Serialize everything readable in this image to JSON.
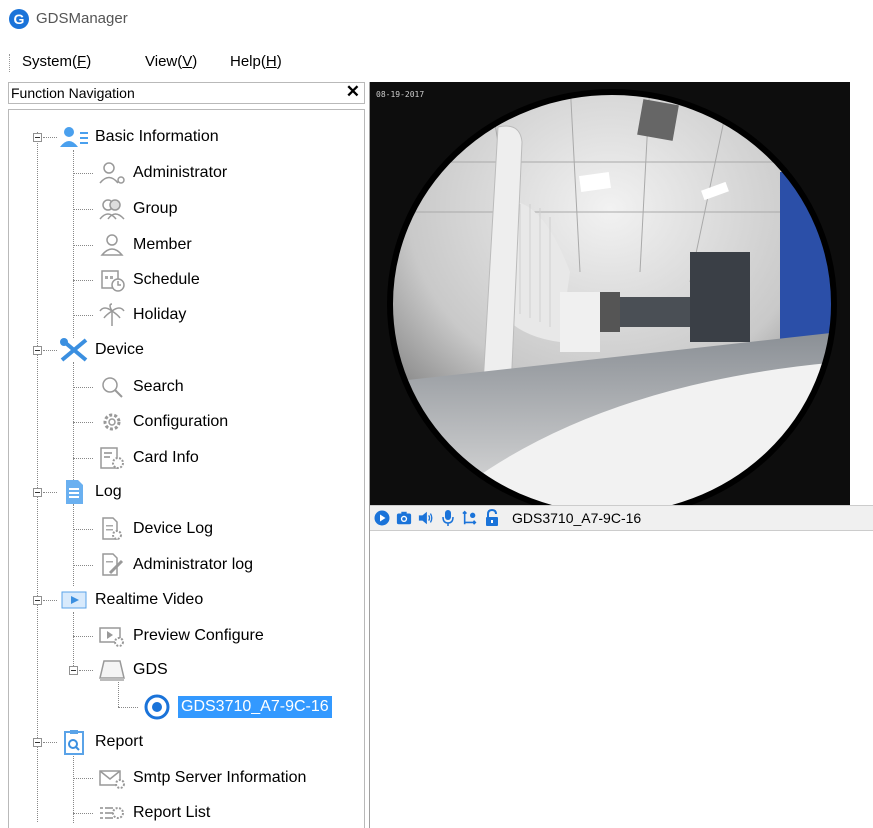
{
  "app": {
    "title": "GDSManager",
    "logo_glyph": "G"
  },
  "menu": [
    {
      "label": "System(",
      "key": "F",
      "end": ")"
    },
    {
      "label": "View(",
      "key": "V",
      "end": ")"
    },
    {
      "label": "Help(",
      "key": "H",
      "end": ")"
    }
  ],
  "nav": {
    "header": "Function Navigation",
    "close_glyph": "✕",
    "items": [
      {
        "label": "Basic Information",
        "icon": "user-list-icon"
      },
      {
        "label": "Administrator",
        "icon": "user-gear-icon"
      },
      {
        "label": "Group",
        "icon": "group-icon"
      },
      {
        "label": "Member",
        "icon": "user-icon"
      },
      {
        "label": "Schedule",
        "icon": "calendar-clock-icon"
      },
      {
        "label": "Holiday",
        "icon": "palm-tree-icon"
      },
      {
        "label": "Device",
        "icon": "tools-icon"
      },
      {
        "label": "Search",
        "icon": "search-icon"
      },
      {
        "label": "Configuration",
        "icon": "gear-icon"
      },
      {
        "label": "Card Info",
        "icon": "card-gear-icon"
      },
      {
        "label": "Log",
        "icon": "document-icon"
      },
      {
        "label": "Device Log",
        "icon": "document-gear-icon"
      },
      {
        "label": "Administrator log",
        "icon": "document-pen-icon"
      },
      {
        "label": "Realtime Video",
        "icon": "play-icon"
      },
      {
        "label": "Preview Configure",
        "icon": "play-gear-icon"
      },
      {
        "label": "GDS",
        "icon": "device-icon"
      },
      {
        "label": "GDS3710_A7-9C-16",
        "icon": "camera-icon"
      },
      {
        "label": "Report",
        "icon": "report-icon"
      },
      {
        "label": "Smtp Server Information",
        "icon": "mail-gear-icon"
      },
      {
        "label": "Report List",
        "icon": "list-gear-icon"
      }
    ]
  },
  "video": {
    "device_name": "GDS3710_A7-9C-16",
    "osd": "08-19-2017",
    "toolbar": [
      "play-icon",
      "snapshot-icon",
      "speaker-icon",
      "microphone-icon",
      "ptz-icon",
      "unlock-icon"
    ]
  },
  "colors": {
    "selection": "#3399ff",
    "accent": "#1a73d9",
    "icon_blue": "#3b8fe0"
  }
}
